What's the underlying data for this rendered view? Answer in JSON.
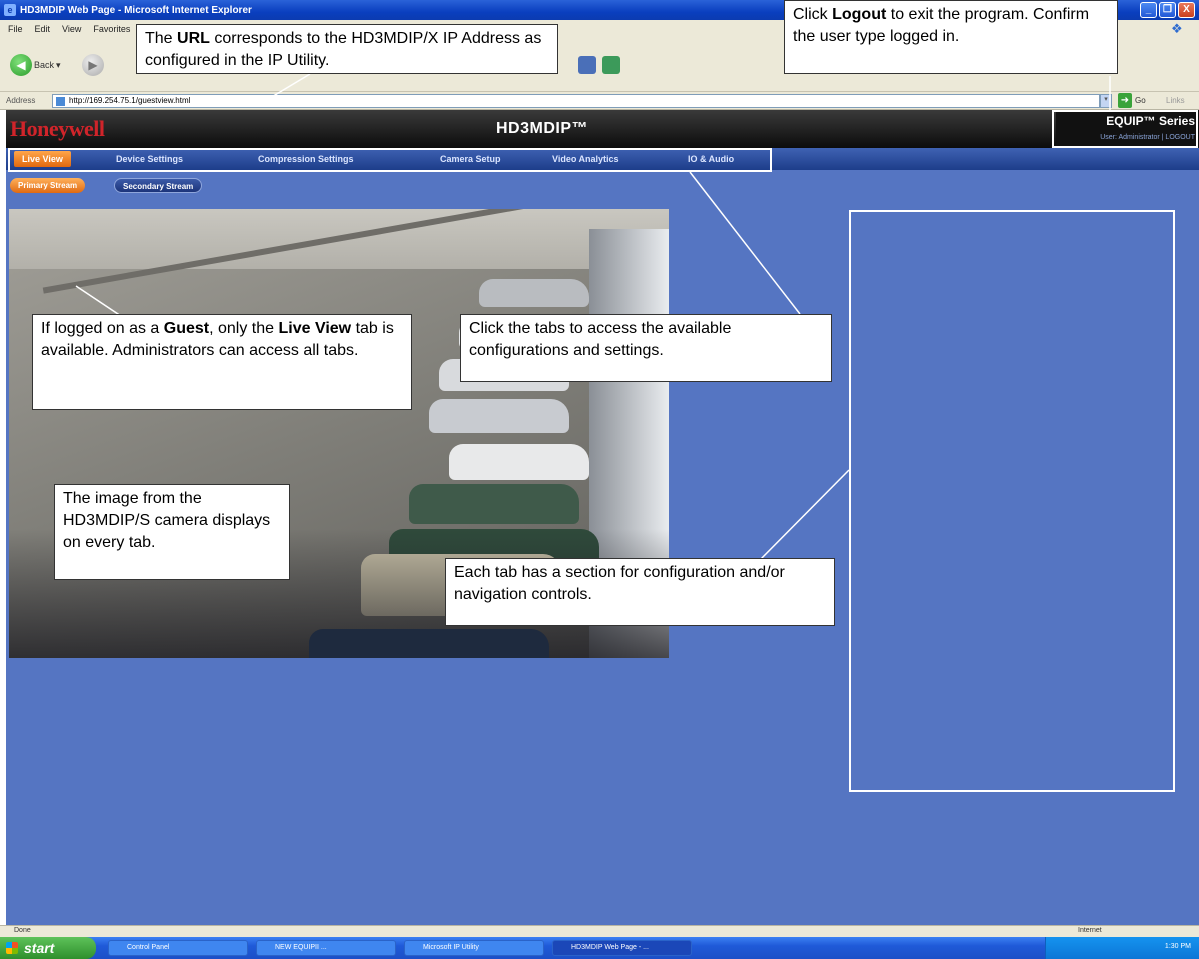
{
  "window": {
    "title": "HD3MDIP Web Page - Microsoft Internet Explorer",
    "minimize": "_",
    "maximize": "❐",
    "close": "X"
  },
  "menu": [
    "File",
    "Edit",
    "View",
    "Favorites"
  ],
  "toolbar": {
    "back_label": "Back"
  },
  "address": {
    "label": "Address",
    "url": "http://169.254.75.1/guestview.html",
    "go_label": "Go",
    "links_label": "Links"
  },
  "header": {
    "brand": "Honeywell",
    "product": "HD3MDIP™",
    "series": "EQUIP™ Series",
    "user_line": "User: Administrator | LOGOUT"
  },
  "tabs": [
    {
      "label": "Live View",
      "active": true
    },
    {
      "label": "Device Settings",
      "active": false
    },
    {
      "label": "Compression Settings",
      "active": false
    },
    {
      "label": "Camera Setup",
      "active": false
    },
    {
      "label": "Video Analytics",
      "active": false
    },
    {
      "label": "IO & Audio",
      "active": false
    }
  ],
  "streams": {
    "primary": "Primary Stream",
    "secondary": "Secondary Stream"
  },
  "callouts": {
    "url": {
      "pre": "The ",
      "bold": "URL",
      "post": " corresponds to the HD3MDIP/X IP Address as configured in the IP Utility."
    },
    "logout": {
      "pre": "Click ",
      "bold": "Logout",
      "post": " to exit the program. Confirm the user type logged in."
    },
    "guest": {
      "p1": "If logged on as a ",
      "b1": "Guest",
      "p2": ", only the ",
      "b2": "Live View",
      "p3": " tab is available. Administrators can access all tabs."
    },
    "tabs": "Click the tabs to access the available configurations and settings.",
    "image": "The image from the HD3MDIP/S camera displays on every tab.",
    "section": "Each tab has a section for configuration and/or navigation controls."
  },
  "status": {
    "left": "Done",
    "right": "Internet"
  },
  "taskbar": {
    "start": "start",
    "tasks": [
      "Control Panel",
      "NEW EQUIPII ...",
      "Microsoft IP Utility",
      "HD3MDIP Web Page - ..."
    ],
    "time": "1:30 PM"
  },
  "colors": {
    "page_background": "#5575c2",
    "active_tab": "#f08a2a",
    "brand_red": "#d0242a",
    "header": "#111111"
  }
}
